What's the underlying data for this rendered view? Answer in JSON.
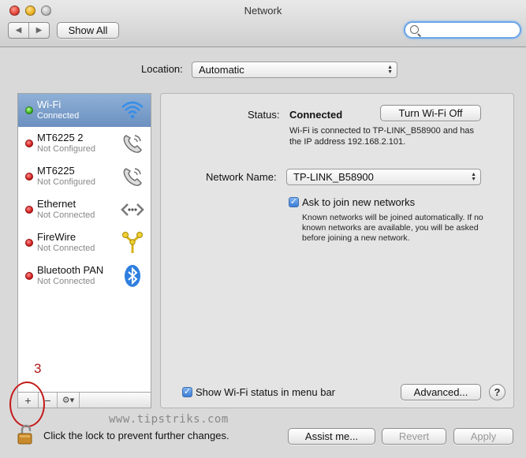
{
  "window": {
    "title": "Network"
  },
  "toolbar": {
    "back_glyph": "◀",
    "forward_glyph": "▶",
    "show_all": "Show All",
    "search_value": ""
  },
  "location": {
    "label": "Location:",
    "value": "Automatic"
  },
  "services": [
    {
      "name": "Wi-Fi",
      "status": "Connected",
      "dot": "green",
      "icon": "wifi-icon",
      "selected": true
    },
    {
      "name": "MT6225  2",
      "status": "Not Configured",
      "dot": "red",
      "icon": "phone-icon",
      "selected": false
    },
    {
      "name": "MT6225",
      "status": "Not Configured",
      "dot": "red",
      "icon": "phone-icon",
      "selected": false
    },
    {
      "name": "Ethernet",
      "status": "Not Connected",
      "dot": "red",
      "icon": "ethernet-icon",
      "selected": false
    },
    {
      "name": "FireWire",
      "status": "Not Connected",
      "dot": "red",
      "icon": "firewire-icon",
      "selected": false
    },
    {
      "name": "Bluetooth PAN",
      "status": "Not Connected",
      "dot": "red",
      "icon": "bluetooth-icon",
      "selected": false
    }
  ],
  "sidebar_bar": {
    "add": "+",
    "remove": "−",
    "action": "⚙▾"
  },
  "annotation": {
    "number": "3"
  },
  "detail": {
    "status_label": "Status:",
    "status_value": "Connected",
    "turn_off": "Turn Wi-Fi Off",
    "status_desc": "Wi-Fi is connected to TP-LINK_B58900 and has the IP address 192.168.2.101.",
    "network_name_label": "Network Name:",
    "network_name_value": "TP-LINK_B58900",
    "ask_label": "Ask to join new networks",
    "ask_checked": true,
    "ask_desc": "Known networks will be joined automatically. If no known networks are available, you will be asked before joining a new network.",
    "show_status_label": "Show Wi-Fi status in menu bar",
    "show_status_checked": true,
    "advanced": "Advanced...",
    "help": "?"
  },
  "footer": {
    "watermark": "www.tipstriks.com",
    "lock_text": "Click the lock to prevent further changes.",
    "assist": "Assist me...",
    "revert": "Revert",
    "apply": "Apply"
  },
  "colors": {
    "selection": "#7a9cc8",
    "wifi_blue": "#3a8ee6",
    "annotation_red": "#c41a1a"
  }
}
